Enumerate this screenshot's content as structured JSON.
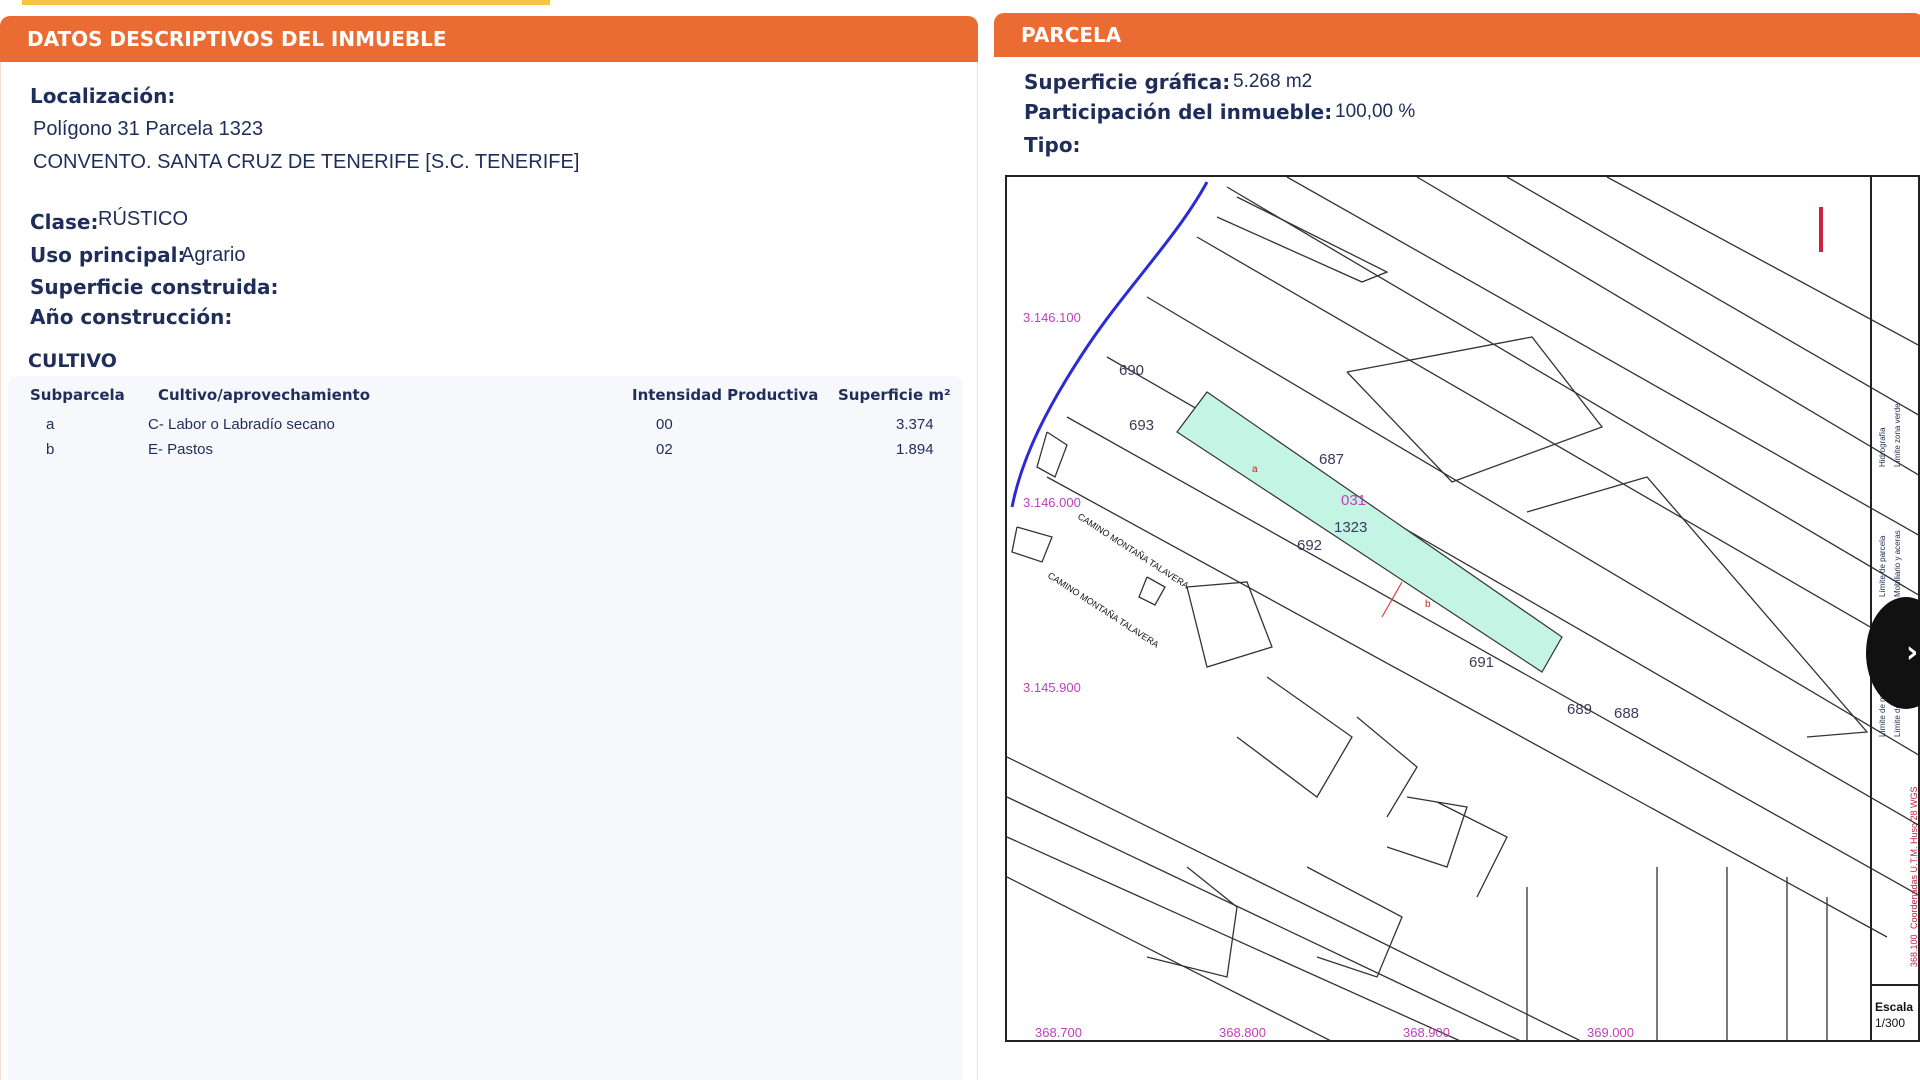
{
  "left_panel": {
    "title": "DATOS DESCRIPTIVOS DEL INMUEBLE",
    "localizacion_label": "Localización:",
    "localizacion_line1": "Polígono 31 Parcela 1323",
    "localizacion_line2": "CONVENTO. SANTA CRUZ DE TENERIFE [S.C. TENERIFE]",
    "clase_label": "Clase:",
    "clase_value": "RÚSTICO",
    "uso_label": "Uso principal:",
    "uso_value": "Agrario",
    "superficie_construida_label": "Superficie construida:",
    "anio_label": "Año construcción:",
    "cultivo": {
      "title": "CULTIVO",
      "headers": [
        "Subparcela",
        "Cultivo/aprovechamiento",
        "Intensidad Productiva",
        "Superficie m²"
      ],
      "rows": [
        [
          "a",
          "C- Labor o Labradío secano",
          "00",
          "3.374"
        ],
        [
          "b",
          "E- Pastos",
          "02",
          "1.894"
        ]
      ]
    }
  },
  "right_panel": {
    "title": "PARCELA",
    "superficie_label": "Superficie gráfica:",
    "superficie_value": "5.268 m2",
    "participacion_label": "Participación del inmueble:",
    "participacion_value": "100,00 %",
    "tipo_label": "Tipo:",
    "map": {
      "highlight_color": "#c4f5e4",
      "parcel_numbers": [
        "690",
        "693",
        "687",
        "031",
        "1323",
        "692",
        "691",
        "689",
        "688"
      ],
      "subparcel_labels": [
        "a",
        "b"
      ],
      "road_labels": [
        "CAMINO MONTAÑA TALAVERA",
        "CAMINO MONTAÑA TALAVERA"
      ],
      "y_coords": [
        "3.146.100",
        "3.146.000",
        "3.145.900"
      ],
      "x_coords": [
        "368.700",
        "368.800",
        "368.900",
        "369.000"
      ],
      "legend_items": [
        "Límite de manzana",
        "Límite de parcela",
        "Límite de construcciones",
        "Mobiliario y aceras",
        "Hidrografía",
        "Límite zona verde"
      ],
      "coords_caption": "Coordenadas U.T.M. Huso 28 WGS",
      "coords_caption_prefix": "368.100",
      "scale_label": "Escala",
      "scale_value": "1/300"
    }
  },
  "nav": {
    "side_button_icon": "chevron-right-icon",
    "side_button_glyph": "›"
  }
}
